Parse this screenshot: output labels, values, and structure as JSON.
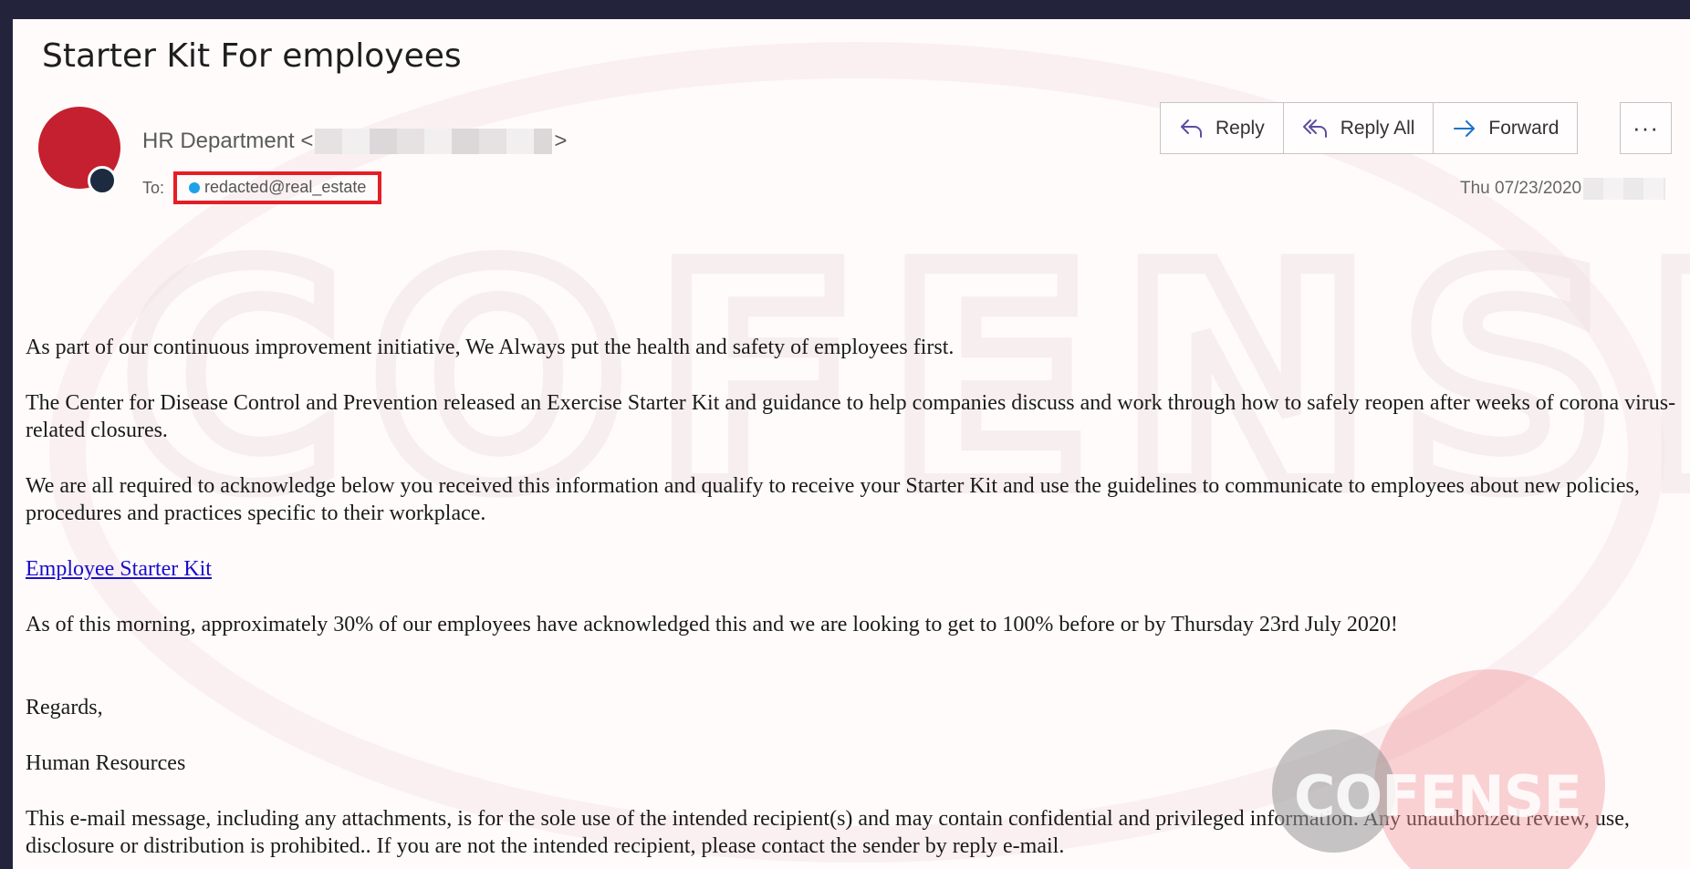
{
  "email": {
    "subject": "Starter Kit For employees",
    "sender": {
      "name": "HR Department <",
      "close": ">",
      "avatar_color": "#c5202f",
      "presence_color": "#1c2b3f"
    },
    "to_label": "To:",
    "recipient": "redacted@real_estate",
    "recipient_dot_color": "#1aa3e8",
    "highlight_color": "#e41e26",
    "date": "Thu 07/23/2020"
  },
  "toolbar": {
    "reply": "Reply",
    "reply_all": "Reply All",
    "forward": "Forward",
    "more": "···",
    "icons": [
      "reply-icon",
      "reply-all-icon",
      "forward-icon",
      "more-icon"
    ]
  },
  "body": {
    "p1": "As part of our continuous improvement initiative, We Always put the health and safety of employees first.",
    "p2": "The Center for Disease Control and Prevention  released an Exercise Starter Kit and guidance to help companies discuss and work through how to safely reopen after weeks of corona virus-related closures.",
    "p3": "We are all required to acknowledge below you received this information and qualify to receive your Starter Kit and use the  guidelines to communicate to employees about new policies, procedures and practices specific to their workplace.",
    "link": "Employee Starter Kit",
    "p4": "As of this morning, approximately 30% of our employees have acknowledged this and we are looking to get to 100% before or by Thursday 23rd July 2020!",
    "regards": "Regards,",
    "signature": "Human Resources",
    "disclaimer": "This e-mail message, including any attachments, is for the sole use of the intended recipient(s) and may contain confidential and privileged information.  Any unauthorized review, use, disclosure or distribution is prohibited..  If you are not the intended recipient, please contact the sender by reply e-mail."
  },
  "watermark": {
    "logo_text": "COFENSE"
  }
}
